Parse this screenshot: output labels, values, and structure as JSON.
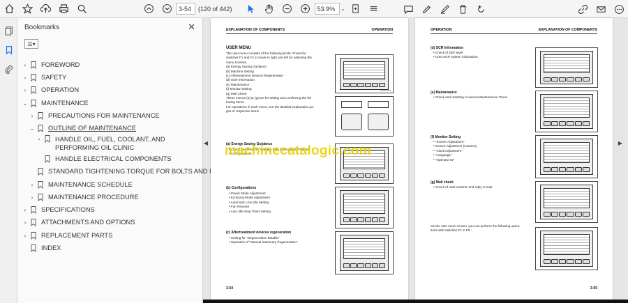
{
  "toolbar": {
    "page_current": "3-54",
    "page_count": "(120 of 442)",
    "zoom": "53.9%"
  },
  "bookmarks": {
    "title": "Bookmarks",
    "items": [
      {
        "label": "FOREWORD",
        "level": 0,
        "chev": "›"
      },
      {
        "label": "SAFETY",
        "level": 0,
        "chev": "›"
      },
      {
        "label": "OPERATION",
        "level": 0,
        "chev": "›"
      },
      {
        "label": "MAINTENANCE",
        "level": 0,
        "chev": "⌄"
      },
      {
        "label": "PRECAUTIONS FOR MAINTENANCE",
        "level": 1,
        "chev": "›"
      },
      {
        "label": "OUTLINE OF MAINTENANCE",
        "level": 1,
        "chev": "⌄"
      },
      {
        "label": "HANDLE OIL, FUEL, COOLANT, AND PERFORMING OIL CLINIC",
        "level": 2,
        "chev": "›"
      },
      {
        "label": "HANDLE ELECTRICAL COMPONENTS",
        "level": 2,
        "chev": ""
      },
      {
        "label": "STANDARD TIGHTENING TORQUE FOR BOLTS AND NUTS",
        "level": 1,
        "chev": ""
      },
      {
        "label": "MAINTENANCE SCHEDULE",
        "level": 1,
        "chev": "›"
      },
      {
        "label": "MAINTENANCE PROCEDURE",
        "level": 1,
        "chev": "›"
      },
      {
        "label": "SPECIFICATIONS",
        "level": 0,
        "chev": "›"
      },
      {
        "label": "ATTACHMENTS AND OPTIONS",
        "level": 0,
        "chev": "›"
      },
      {
        "label": "REPLACEMENT PARTS",
        "level": 0,
        "chev": "›"
      },
      {
        "label": "INDEX",
        "level": 0,
        "chev": ""
      }
    ]
  },
  "left_page": {
    "header_left": "EXPLANATION OF COMPONENTS",
    "header_right": "OPERATION",
    "title": "USER MENU",
    "intro": [
      "The user menu consists of the following kinds. Press the",
      "switches F1 and F2 to move to right and left for selecting the",
      "menu screens.",
      "(a)  Energy Saving Guidance",
      "(b)  Machine Setting",
      "(c)  Aftertreatment Devices Regeneration",
      "(d)  SCR Information",
      "(e)  Maintenance",
      "(f)  Monitor Setting",
      "(g)  Mail Check",
      "These menus (a) to (g) are for setting and confirming the fol-",
      "lowing items.",
      "For operations in each menu, see the detailed explanation pa-",
      "ges of respective items."
    ],
    "sec_a_title": "(a) Energy Saving Guidance",
    "sec_a_items": [
      "Check and reset of \"Average Fuel Consumption Record\"",
      "Configurations"
    ],
    "sec_b_title": "(b) Configurations",
    "sec_b_items": [
      "Power Mode Adjustment",
      "Economy Mode Adjustment",
      "Automatic Low Idle Setting",
      "Fan Reverse",
      "Auto Idle Stop Timer Setting"
    ],
    "sec_c_title": "(c) Aftertreatment devices regeneration",
    "sec_c_items": [
      "Setting for \"Regeneration Disable\"",
      "Operation of \"Manual Stationary Regeneration\""
    ],
    "footer": "3-54"
  },
  "right_page": {
    "header_left": "OPERATION",
    "header_right": "EXPLANATION OF COMPONENTS",
    "sec_d_title": "(d) SCR Information",
    "sec_d_items": [
      "Check of DEF level",
      "Urea SCR system information"
    ],
    "sec_e_title": "(e) Maintenance",
    "sec_e_items": [
      "Check and resetting of various Maintenance Times"
    ],
    "sec_f_title": "(f) Monitor Setting",
    "sec_f_items": [
      "\"Screen Adjustment\"",
      "Screen Adjustment (Camera)",
      "\"Clock Adjustment\"",
      "\"Language\"",
      "\"Operator ID\""
    ],
    "sec_g_title": "(g) Mail check",
    "sec_g_items": [
      "Check of mail contents and reply to mail"
    ],
    "closing": [
      "On the user menu screen, you can perform the following opera-",
      "tions with switches F1 to F6 :"
    ],
    "footer": "3-55"
  },
  "watermark": "machinecatalogic.com"
}
